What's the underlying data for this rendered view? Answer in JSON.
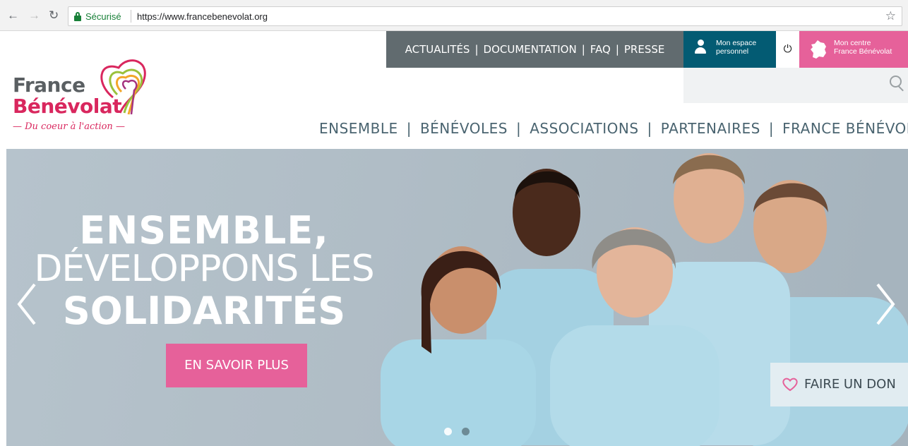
{
  "browser": {
    "secure_label": "Sécurisé",
    "url": "https://www.francebenevolat.org"
  },
  "topbar": {
    "links": [
      "ACTUALITÉS",
      "DOCUMENTATION",
      "FAQ",
      "PRESSE"
    ],
    "espace_line1": "Mon espace",
    "espace_line2": "personnel",
    "centre_line1": "Mon centre",
    "centre_line2": "France Bénévolat"
  },
  "logo": {
    "line1": "France",
    "line2": "Bénévolat",
    "tagline": "— Du coeur à l'action —"
  },
  "mainnav": {
    "items": [
      "ENSEMBLE",
      "BÉNÉVOLES",
      "ASSOCIATIONS",
      "PARTENAIRES",
      "FRANCE BÉNÉVOLAT"
    ]
  },
  "hero": {
    "line1": "ENSEMBLE,",
    "line2": "DÉVELOPPONS LES",
    "line3": "SOLIDARITÉS",
    "cta": "EN SAVOIR PLUS",
    "donate": "FAIRE UN DON",
    "slides_total": 2,
    "active_slide": 1
  },
  "colors": {
    "brand_pink": "#e6619a",
    "brand_teal": "#035b73",
    "topbar_gray": "#616b6f",
    "nav_text": "#4a6470"
  },
  "icons": {
    "back": "arrow-left-icon",
    "forward": "arrow-right-icon",
    "reload": "reload-icon",
    "lock": "lock-icon",
    "bookmark": "star-icon",
    "user": "user-icon",
    "power": "power-icon",
    "france_map": "france-map-icon",
    "search": "search-icon",
    "heart": "heart-icon"
  }
}
